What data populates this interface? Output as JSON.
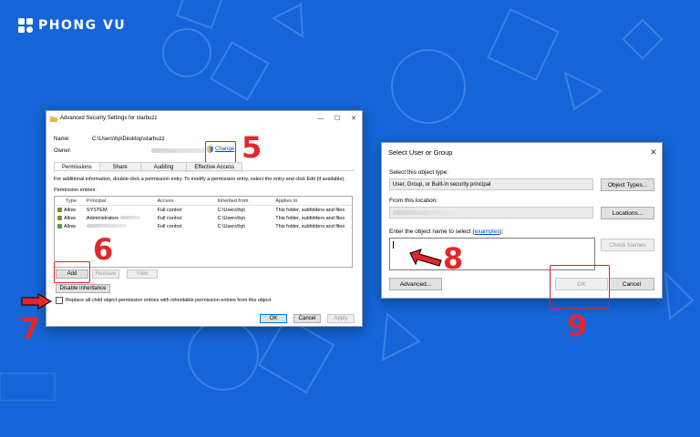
{
  "brand": {
    "name": "PHONG VU"
  },
  "advanced_security": {
    "title": "Advanced Security Settings for starbuzz",
    "name_label": "Name:",
    "name_value": "C:\\Users\\hp\\Desktop\\starbuzz",
    "owner_label": "Owner:",
    "change_label": "Change",
    "tabs": [
      "Permissions",
      "Share",
      "Auditing",
      "Effective Access"
    ],
    "info_text": "For additional information, double-click a permission entry. To modify a permission entry, select the entry and click Edit (if available).",
    "entries_label": "Permission entries:",
    "columns": [
      "Type",
      "Principal",
      "Access",
      "Inherited from",
      "Applies to"
    ],
    "rows": [
      {
        "type": "Allow",
        "principal": "SYSTEM",
        "access": "Full control",
        "inherited": "C:\\Users\\hp\\",
        "applies": "This folder, subfolders and files"
      },
      {
        "type": "Allow",
        "principal": "Administrators",
        "access": "Full control",
        "inherited": "C:\\Users\\hp\\",
        "applies": "This folder, subfolders and files"
      },
      {
        "type": "Allow",
        "principal": "",
        "access": "Full control",
        "inherited": "C:\\Users\\hp\\",
        "applies": "This folder, subfolders and files"
      }
    ],
    "add_label": "Add",
    "remove_label": "Remove",
    "view_label": "View",
    "disable_inheritance_label": "Disable inheritance",
    "replace_label": "Replace all child object permission entries with inheritable permission entries from this object",
    "ok_label": "OK",
    "cancel_label": "Cancel",
    "apply_label": "Apply"
  },
  "select_user": {
    "title": "Select User or Group",
    "object_type_label": "Select this object type:",
    "object_type_value": "User, Group, or Built-in security principal",
    "object_types_button": "Object Types...",
    "location_label": "From this location:",
    "locations_button": "Locations...",
    "enter_label_prefix": "Enter the object name to select (",
    "examples_link": "examples",
    "enter_label_suffix": "):",
    "check_names_button": "Check Names",
    "advanced_button": "Advanced...",
    "ok_label": "OK",
    "cancel_label": "Cancel"
  },
  "steps": [
    "5",
    "6",
    "7",
    "8",
    "9"
  ],
  "colors": {
    "background": "#1565d8",
    "step_red": "#e3262b"
  }
}
